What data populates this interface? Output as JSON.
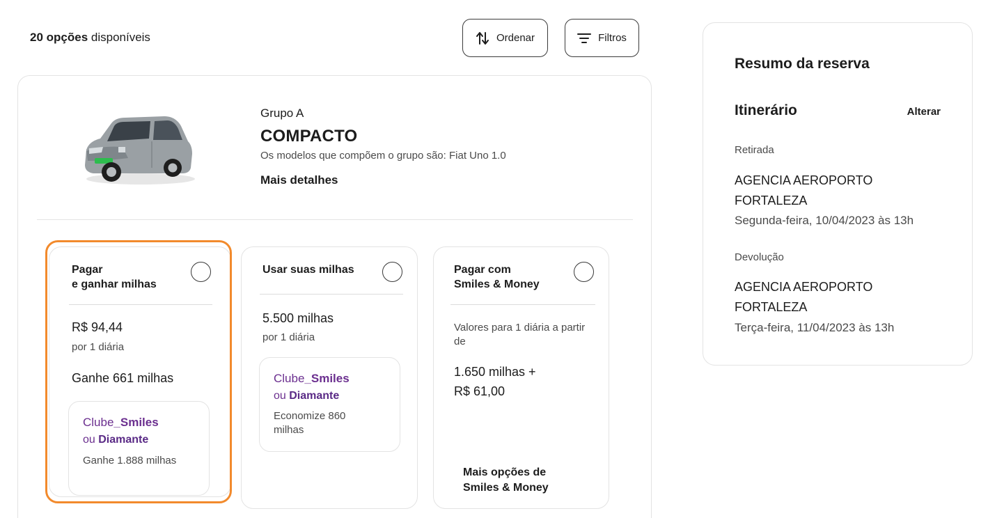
{
  "header": {
    "count": "20 opções",
    "count_suffix": " disponíveis",
    "sort_label": "Ordenar",
    "filter_label": "Filtros"
  },
  "car": {
    "group": "Grupo A",
    "title": "COMPACTO",
    "description": "Os modelos que compõem o grupo são: Fiat Uno 1.0",
    "more_details": "Mais detalhes"
  },
  "options": [
    {
      "title_line1": "Pagar",
      "title_line2": "e ganhar milhas",
      "price": "R$ 94,44",
      "per": "por 1 diária",
      "earn": "Ganhe 661 milhas",
      "club_prefix": "Clube",
      "club_name": "_Smiles",
      "club_or": "ou ",
      "club_tier": "Diamante",
      "club_note": "Ganhe 1.888 milhas",
      "selected": true
    },
    {
      "title_line1": "Usar suas milhas",
      "price": "5.500 milhas",
      "per": "por 1 diária",
      "club_prefix": "Clube",
      "club_name": "_Smiles",
      "club_or": "ou ",
      "club_tier": "Diamante",
      "club_note": "Economize 860 milhas",
      "selected": false
    },
    {
      "title_line1": "Pagar com",
      "title_line2": "Smiles & Money",
      "intro": "Valores para 1 diária a partir de",
      "price_line1": "1.650 milhas +",
      "price_line2": "R$ 61,00",
      "more_line1": "Mais opções de",
      "more_line2": "Smiles & Money",
      "selected": false
    }
  ],
  "summary": {
    "title": "Resumo da reserva",
    "itinerary_title": "Itinerário",
    "edit_label": "Alterar",
    "pickup_label": "Retirada",
    "pickup_place_line1": "AGENCIA AEROPORTO",
    "pickup_place_line2": "FORTALEZA",
    "pickup_when": "Segunda-feira, 10/04/2023 às 13h",
    "return_label": "Devolução",
    "return_place_line1": "AGENCIA AEROPORTO",
    "return_place_line2": "FORTALEZA",
    "return_when": "Terça-feira, 11/04/2023 às 13h"
  },
  "colors": {
    "accent_selected": "#f28a2c",
    "club_purple": "#6b2f8f"
  }
}
